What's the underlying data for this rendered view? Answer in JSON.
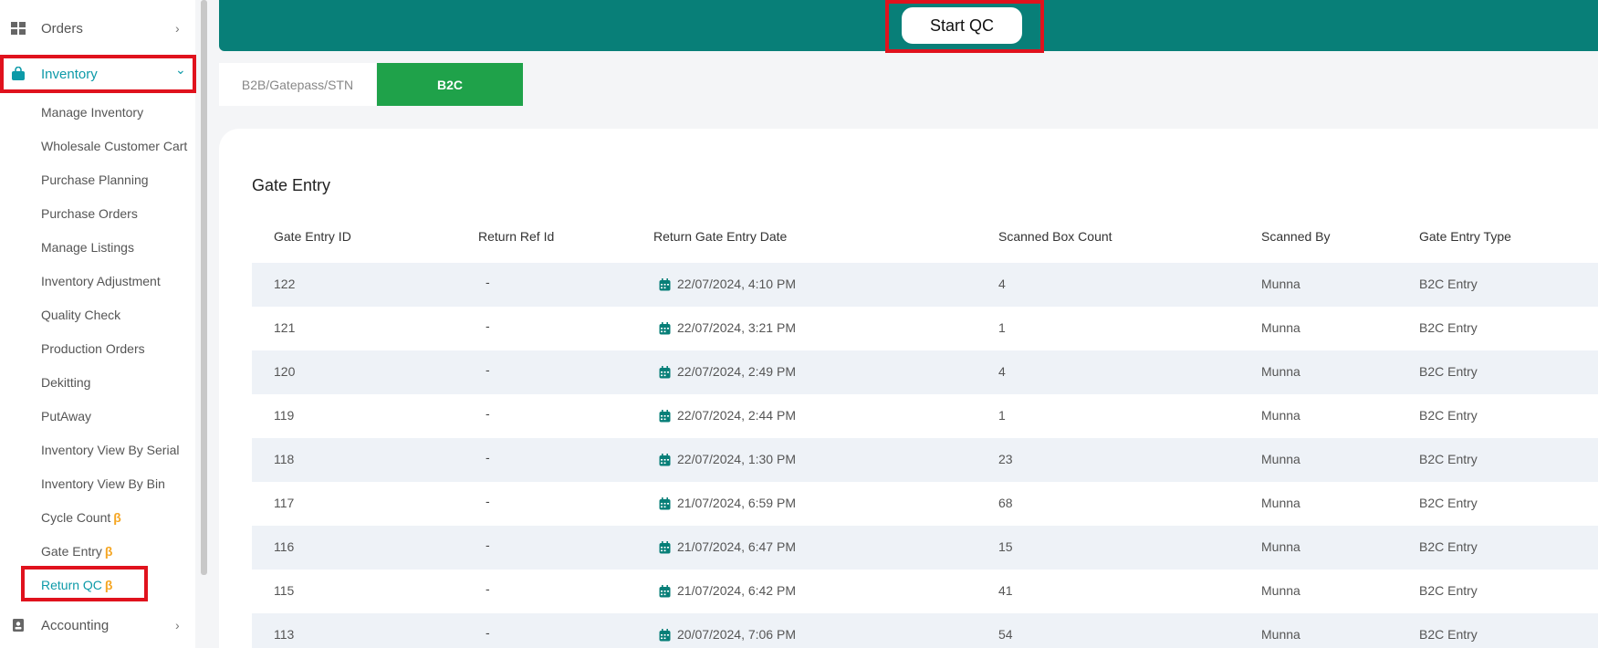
{
  "sidebar": {
    "orders": {
      "label": "Orders",
      "icon": "grid-icon",
      "chevron": "›"
    },
    "inventory": {
      "label": "Inventory",
      "icon": "bag-icon",
      "chevron": "⌄"
    },
    "sub_items": [
      {
        "label": "Manage Inventory"
      },
      {
        "label": "Wholesale Customer Cart"
      },
      {
        "label": "Purchase Planning"
      },
      {
        "label": "Purchase Orders"
      },
      {
        "label": "Manage Listings"
      },
      {
        "label": "Inventory Adjustment"
      },
      {
        "label": "Quality Check"
      },
      {
        "label": "Production Orders"
      },
      {
        "label": "Dekitting"
      },
      {
        "label": "PutAway"
      },
      {
        "label": "Inventory View By Serial"
      },
      {
        "label": "Inventory View By Bin"
      },
      {
        "label": "Cycle Count",
        "beta": "β"
      },
      {
        "label": "Gate Entry",
        "beta": "β"
      },
      {
        "label": "Return QC",
        "beta": "β"
      }
    ],
    "accounting": {
      "label": "Accounting",
      "icon": "contact-book-icon",
      "chevron": "›"
    }
  },
  "topbar": {
    "start_qc_label": "Start QC"
  },
  "tabs": [
    {
      "label": "B2B/Gatepass/STN",
      "active": false
    },
    {
      "label": "B2C",
      "active": true
    }
  ],
  "gate_entry": {
    "title": "Gate Entry",
    "columns": [
      "Gate Entry ID",
      "Return Ref Id",
      "Return Gate Entry Date",
      "Scanned Box Count",
      "Scanned By",
      "Gate Entry Type"
    ],
    "rows": [
      {
        "id": "122",
        "ref": "-",
        "date": "22/07/2024, 4:10 PM",
        "count": "4",
        "by": "Munna",
        "type": "B2C Entry"
      },
      {
        "id": "121",
        "ref": "-",
        "date": "22/07/2024, 3:21 PM",
        "count": "1",
        "by": "Munna",
        "type": "B2C Entry"
      },
      {
        "id": "120",
        "ref": "-",
        "date": "22/07/2024, 2:49 PM",
        "count": "4",
        "by": "Munna",
        "type": "B2C Entry"
      },
      {
        "id": "119",
        "ref": "-",
        "date": "22/07/2024, 2:44 PM",
        "count": "1",
        "by": "Munna",
        "type": "B2C Entry"
      },
      {
        "id": "118",
        "ref": "-",
        "date": "22/07/2024, 1:30 PM",
        "count": "23",
        "by": "Munna",
        "type": "B2C Entry"
      },
      {
        "id": "117",
        "ref": "-",
        "date": "21/07/2024, 6:59 PM",
        "count": "68",
        "by": "Munna",
        "type": "B2C Entry"
      },
      {
        "id": "116",
        "ref": "-",
        "date": "21/07/2024, 6:47 PM",
        "count": "15",
        "by": "Munna",
        "type": "B2C Entry"
      },
      {
        "id": "115",
        "ref": "-",
        "date": "21/07/2024, 6:42 PM",
        "count": "41",
        "by": "Munna",
        "type": "B2C Entry"
      },
      {
        "id": "113",
        "ref": "-",
        "date": "20/07/2024, 7:06 PM",
        "count": "54",
        "by": "Munna",
        "type": "B2C Entry"
      }
    ]
  },
  "colors": {
    "brand": "#087f78",
    "active_tab": "#1fa24a",
    "accent": "#0d9aa8",
    "highlight": "#e0121d",
    "beta": "#f5a623"
  }
}
